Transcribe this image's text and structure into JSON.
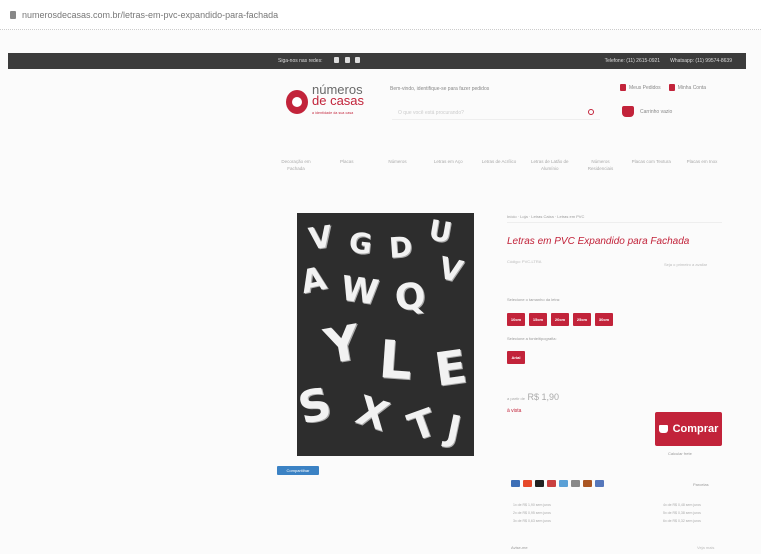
{
  "browser": {
    "url": "numerosdecasas.com.br/letras-em-pvc-expandido-para-fachada"
  },
  "topbar": {
    "follow": "Siga-nos nas redes:",
    "social": [
      "facebook-icon",
      "instagram-icon",
      "pinterest-icon"
    ],
    "phone": "Telefone: (11) 2615-0921",
    "whatsapp": "Whatsapp: (11) 99574-8639"
  },
  "logo": {
    "line1": "números",
    "line2": "de casas",
    "tagline": "a identidade da sua casa"
  },
  "header": {
    "welcome": "Bem-vindo, identifique-se para fazer pedidos",
    "search_placeholder": "O que você está procurando?",
    "my_orders": "Meus Pedidos",
    "wishlist": "Minha Conta",
    "cart": "Carrinho vazio"
  },
  "nav": [
    "Decoração em Fachada",
    "Placas",
    "Números",
    "Letras em Aço",
    "Letras de Acrílico",
    "Letras de Latão de Alumínio",
    "Números Residenciais",
    "Placas com Textura",
    "Placas em Inox"
  ],
  "product": {
    "breadcrumb": "Início · Loja · Letras Caixa · Letras em PVC",
    "title": "Letras em PVC Expandido para Fachada",
    "ref": "Código: PVC-LTRA",
    "reviews": "Seja o primeiro a avaliar",
    "size_label": "Selecione o tamanho da letra:",
    "sizes": [
      "10cm",
      "15cm",
      "20cm",
      "25cm",
      "30cm"
    ],
    "font_label": "Selecione a fonte/tipografia:",
    "font_option": "Arial",
    "price_prefix": "a partir de",
    "price": "R$ 1,90",
    "installments": "à vista",
    "buy": "Comprar",
    "shipping": "Calcular frete"
  },
  "share": "Compartilhar",
  "payments": {
    "toggle": "Parcelas",
    "icons": [
      {
        "name": "visa-icon",
        "color": "#3d6fb6"
      },
      {
        "name": "mastercard-icon",
        "color": "#e6492a"
      },
      {
        "name": "elo-icon",
        "color": "#222222"
      },
      {
        "name": "amex-icon",
        "color": "#c94040"
      },
      {
        "name": "hipercard-icon",
        "color": "#5aa0d6"
      },
      {
        "name": "diners-icon",
        "color": "#888888"
      },
      {
        "name": "boleto-icon",
        "color": "#aa5522"
      },
      {
        "name": "pix-icon",
        "color": "#5577bb"
      }
    ],
    "rows": [
      "1x de R$ 1,90 sem juros",
      "4x de R$ 0,48 sem juros",
      "2x de R$ 0,95 sem juros",
      "5x de R$ 0,38 sem juros",
      "3x de R$ 0,63 sem juros",
      "6x de R$ 0,32 sem juros"
    ]
  },
  "footer": {
    "left": "Avise-me",
    "right": "Veja mais"
  },
  "photo_letters": [
    "V",
    "G",
    "D",
    "U",
    "A",
    "W",
    "Q",
    "V",
    "Y",
    "L",
    "E",
    "S",
    "X",
    "T",
    "J"
  ]
}
